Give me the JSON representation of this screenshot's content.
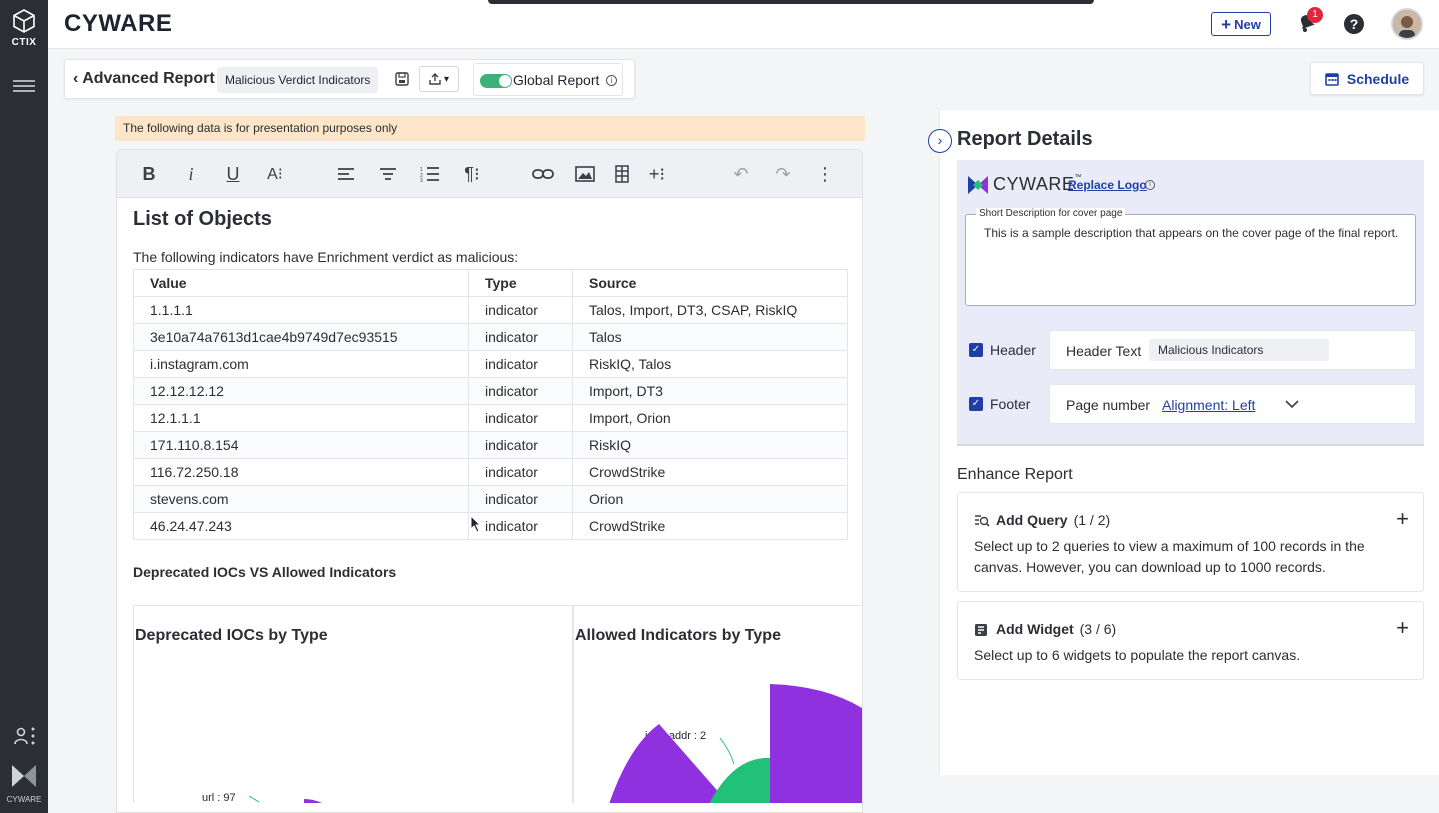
{
  "rail": {
    "product": "CTIX",
    "footer_brand": "CYWARE"
  },
  "topbar": {
    "brand": "CYWARE",
    "new_label": "New",
    "notification_count": "1",
    "help_glyph": "?"
  },
  "report_bar": {
    "back_title": "Advanced Report",
    "report_name": "Malicious Verdict Indicators",
    "global_label": "Global Report",
    "global_on": true
  },
  "schedule_label": "Schedule",
  "notice": "The following data is for presentation purposes only",
  "editor": {
    "heading": "List of Objects",
    "intro": "The following indicators have Enrichment verdict as malicious:",
    "table": {
      "headers": [
        "Value",
        "Type",
        "Source"
      ],
      "rows": [
        [
          "1.1.1.1",
          "indicator",
          "Talos, Import, DT3, CSAP, RiskIQ"
        ],
        [
          "3e10a74a7613d1cae4b9749d7ec93515",
          "indicator",
          "Talos"
        ],
        [
          "i.instagram.com",
          "indicator",
          "RiskIQ, Talos"
        ],
        [
          "12.12.12.12",
          "indicator",
          "Import, DT3"
        ],
        [
          "12.1.1.1",
          "indicator",
          "Import, Orion"
        ],
        [
          "171.110.8.154",
          "indicator",
          "RiskIQ"
        ],
        [
          "116.72.250.18",
          "indicator",
          "CrowdStrike"
        ],
        [
          "stevens.com",
          "indicator",
          "Orion"
        ],
        [
          "46.24.47.243",
          "indicator",
          "CrowdStrike"
        ]
      ]
    },
    "section_heading": "Deprecated IOCs VS Allowed Indicators",
    "charts": {
      "left_title": "Deprecated IOCs by Type",
      "left_label": "url : 97",
      "right_title": "Allowed Indicators by Type",
      "right_label": "ipv4-addr : 2"
    }
  },
  "right_panel": {
    "title": "Report Details",
    "logo_text": "CYWARE",
    "logo_tm": "™",
    "replace_logo": "Replace Logo",
    "desc_legend": "Short Description for cover page",
    "desc_text": "This is a sample description that appears on the cover page of the final report.",
    "header": {
      "label": "Header",
      "key": "Header Text",
      "value": "Malicious Indicators",
      "checked": true
    },
    "footer": {
      "label": "Footer",
      "key": "Page number",
      "alignment": "Alignment: Left",
      "checked": true
    },
    "enhance_title": "Enhance Report",
    "add_query": {
      "name": "Add Query",
      "count": "(1 / 2)",
      "desc": "Select up to 2 queries to view a maximum of 100 records in the canvas. However, you can download up to 1000 records."
    },
    "add_widget": {
      "name": "Add Widget",
      "count": "(3 / 6)",
      "desc": "Select up to 6 widgets to populate the report canvas."
    }
  },
  "colors": {
    "accent": "#1f3fa6",
    "rail": "#2b2e33",
    "toggle": "#3bb27a",
    "notice": "#fce5c9",
    "pie_purple": "#9031e0",
    "pie_green": "#21c17a"
  }
}
